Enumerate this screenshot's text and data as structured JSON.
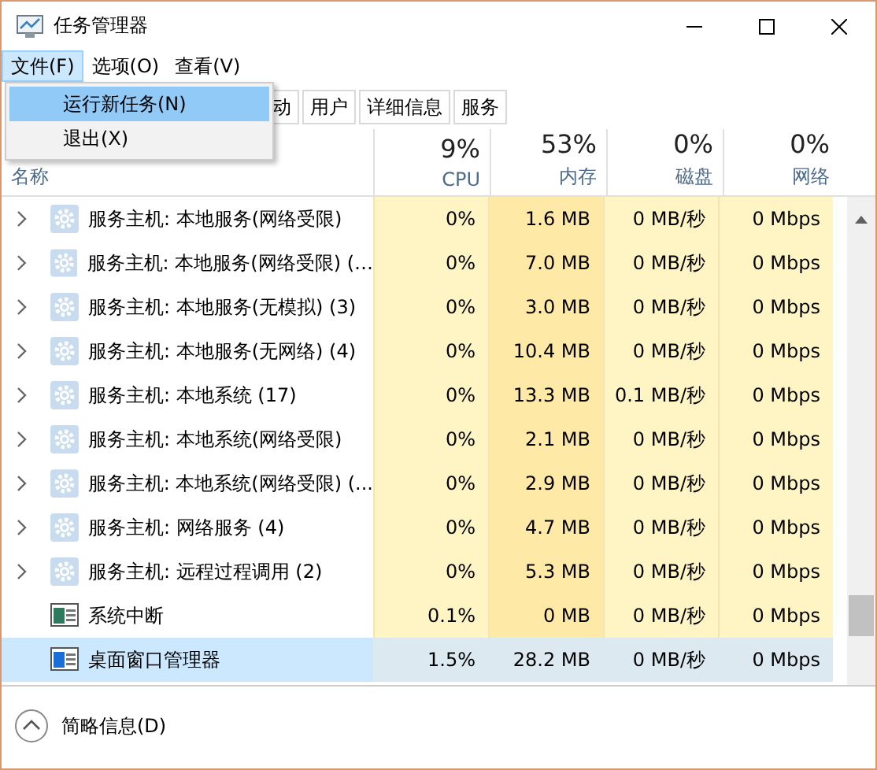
{
  "window": {
    "title": "任务管理器"
  },
  "menu_bar": [
    {
      "label": "文件(F)",
      "selected": true
    },
    {
      "label": "选项(O)",
      "selected": false
    },
    {
      "label": "查看(V)",
      "selected": false
    }
  ],
  "menu": [
    {
      "label": "运行新任务(N)",
      "selected": true
    },
    {
      "label": "退出(X)",
      "selected": false
    }
  ],
  "tabs": [
    {
      "label": "动",
      "selected": false
    },
    {
      "label": "用户",
      "selected": false
    },
    {
      "label": "详细信息",
      "selected": false
    },
    {
      "label": "服务",
      "selected": false
    }
  ],
  "table": {
    "name_column": {
      "label": "名称"
    },
    "columns": [
      {
        "usage": "9%",
        "label": "CPU"
      },
      {
        "usage": "53%",
        "label": "内存"
      },
      {
        "usage": "0%",
        "label": "磁盘"
      },
      {
        "usage": "0%",
        "label": "网络"
      }
    ],
    "rows": [
      {
        "kind": "service-group",
        "name": "服务主机: 本地服务(网络受限)",
        "cells": [
          "0%",
          "1.6 MB",
          "0 MB/秒",
          "0 Mbps"
        ],
        "selected": false
      },
      {
        "kind": "service-group",
        "name": "服务主机: 本地服务(网络受限) (…",
        "cells": [
          "0%",
          "7.0 MB",
          "0 MB/秒",
          "0 Mbps"
        ],
        "selected": false
      },
      {
        "kind": "service-group",
        "name": "服务主机: 本地服务(无模拟) (3)",
        "cells": [
          "0%",
          "3.0 MB",
          "0 MB/秒",
          "0 Mbps"
        ],
        "selected": false
      },
      {
        "kind": "service-group",
        "name": "服务主机: 本地服务(无网络) (4)",
        "cells": [
          "0%",
          "10.4 MB",
          "0 MB/秒",
          "0 Mbps"
        ],
        "selected": false
      },
      {
        "kind": "service-group",
        "name": "服务主机: 本地系统 (17)",
        "cells": [
          "0%",
          "13.3 MB",
          "0.1 MB/秒",
          "0 Mbps"
        ],
        "selected": false
      },
      {
        "kind": "service-group",
        "name": "服务主机: 本地系统(网络受限)",
        "cells": [
          "0%",
          "2.1 MB",
          "0 MB/秒",
          "0 Mbps"
        ],
        "selected": false
      },
      {
        "kind": "service-group",
        "name": "服务主机: 本地系统(网络受限) (...",
        "cells": [
          "0%",
          "2.9 MB",
          "0 MB/秒",
          "0 Mbps"
        ],
        "selected": false
      },
      {
        "kind": "service-group",
        "name": "服务主机: 网络服务 (4)",
        "cells": [
          "0%",
          "4.7 MB",
          "0 MB/秒",
          "0 Mbps"
        ],
        "selected": false
      },
      {
        "kind": "service-group",
        "name": "服务主机: 远程过程调用 (2)",
        "cells": [
          "0%",
          "5.3 MB",
          "0 MB/秒",
          "0 Mbps"
        ],
        "selected": false
      },
      {
        "kind": "process",
        "name": "系统中断",
        "cells": [
          "0.1%",
          "0 MB",
          "0 MB/秒",
          "0 Mbps"
        ],
        "selected": false
      },
      {
        "kind": "process",
        "name": "桌面窗口管理器",
        "cells": [
          "1.5%",
          "28.2 MB",
          "0 MB/秒",
          "0 Mbps"
        ],
        "selected": true
      }
    ]
  },
  "footer": {
    "label": "简略信息(D)"
  }
}
